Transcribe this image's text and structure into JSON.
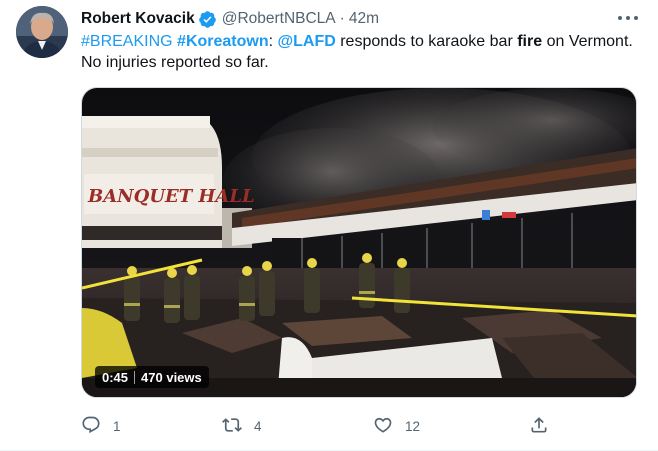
{
  "tweet": {
    "author_name": "Robert Kovacik",
    "author_handle": "@RobertNBCLA",
    "separator": "·",
    "time": "42m",
    "text_parts": [
      {
        "t": "#BREAKING",
        "k": "link"
      },
      {
        "t": " ",
        "k": "plain"
      },
      {
        "t": "#Koreatown",
        "k": "link"
      },
      {
        "t": ":  ",
        "k": "plain"
      },
      {
        "t": "@LAFD",
        "k": "link"
      },
      {
        "t": " responds to karaoke bar ",
        "k": "plain"
      },
      {
        "t": "fire",
        "k": "bold"
      },
      {
        "t": " on Vermont.  No injuries reported so far.",
        "k": "plain"
      }
    ],
    "media": {
      "sign_text": "BANQUET HALL",
      "duration": "0:45",
      "views": "470 views"
    },
    "actions": {
      "replies": "1",
      "retweets": "4",
      "likes": "12"
    }
  },
  "icons": {
    "verified": "verified-badge-icon",
    "more": "more-options-icon",
    "reply": "reply-icon",
    "retweet": "retweet-icon",
    "like": "heart-icon",
    "share": "share-icon"
  },
  "colors": {
    "link": "#1d9bf0",
    "text": "#0f1419",
    "secondary": "#536471",
    "verified": "#1d9bf0"
  }
}
